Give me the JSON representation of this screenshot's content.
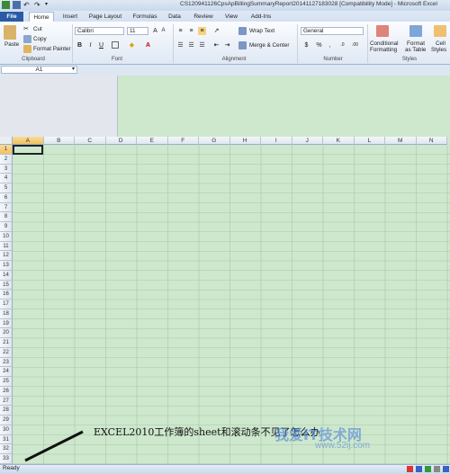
{
  "window": {
    "title": "CS120941126CpsApBillingSummaryReport20141127183028  [Compatibility Mode] - Microsoft Excel"
  },
  "tabs": [
    "File",
    "Home",
    "Insert",
    "Page Layout",
    "Formulas",
    "Data",
    "Review",
    "View",
    "Add-Ins"
  ],
  "clipboard": {
    "paste": "Paste",
    "cut": "Cut",
    "copy": "Copy",
    "format_painter": "Format Painter",
    "label": "Clipboard"
  },
  "font": {
    "name": "Calibri",
    "size": "11",
    "bold": "B",
    "italic": "I",
    "underline": "U",
    "label": "Font"
  },
  "alignment": {
    "wrap_text": "Wrap Text",
    "merge_center": "Merge & Center",
    "label": "Alignment"
  },
  "number": {
    "format": "General",
    "currency": "$",
    "percent": "%",
    "comma": ",",
    "label": "Number"
  },
  "styles": {
    "conditional": "Conditional",
    "conditional2": "Formatting",
    "format_as": "Format",
    "format_as2": "as Table",
    "cell": "Cell",
    "cell2": "Styles",
    "label": "Styles"
  },
  "namebox": {
    "value": "A1"
  },
  "columns": [
    "A",
    "B",
    "C",
    "D",
    "E",
    "F",
    "G",
    "H",
    "I",
    "J",
    "K",
    "L",
    "M",
    "N"
  ],
  "rows": [
    "1",
    "2",
    "3",
    "4",
    "5",
    "6",
    "7",
    "8",
    "9",
    "10",
    "11",
    "12",
    "13",
    "14",
    "15",
    "16",
    "17",
    "18",
    "19",
    "20",
    "21",
    "22",
    "23",
    "24",
    "25",
    "26",
    "27",
    "28",
    "29",
    "30",
    "31",
    "32",
    "33"
  ],
  "annotation": "EXCEL2010工作簿的sheet和滚动条不见了怎么办",
  "status": "Ready",
  "watermark": {
    "text": "我爱IT技术网",
    "url": "www.52ij.com"
  },
  "colors": {
    "file_tab": "#2a5aa4",
    "sheet_bg": "#cde8cd",
    "selected_header": "#f1c15f"
  }
}
